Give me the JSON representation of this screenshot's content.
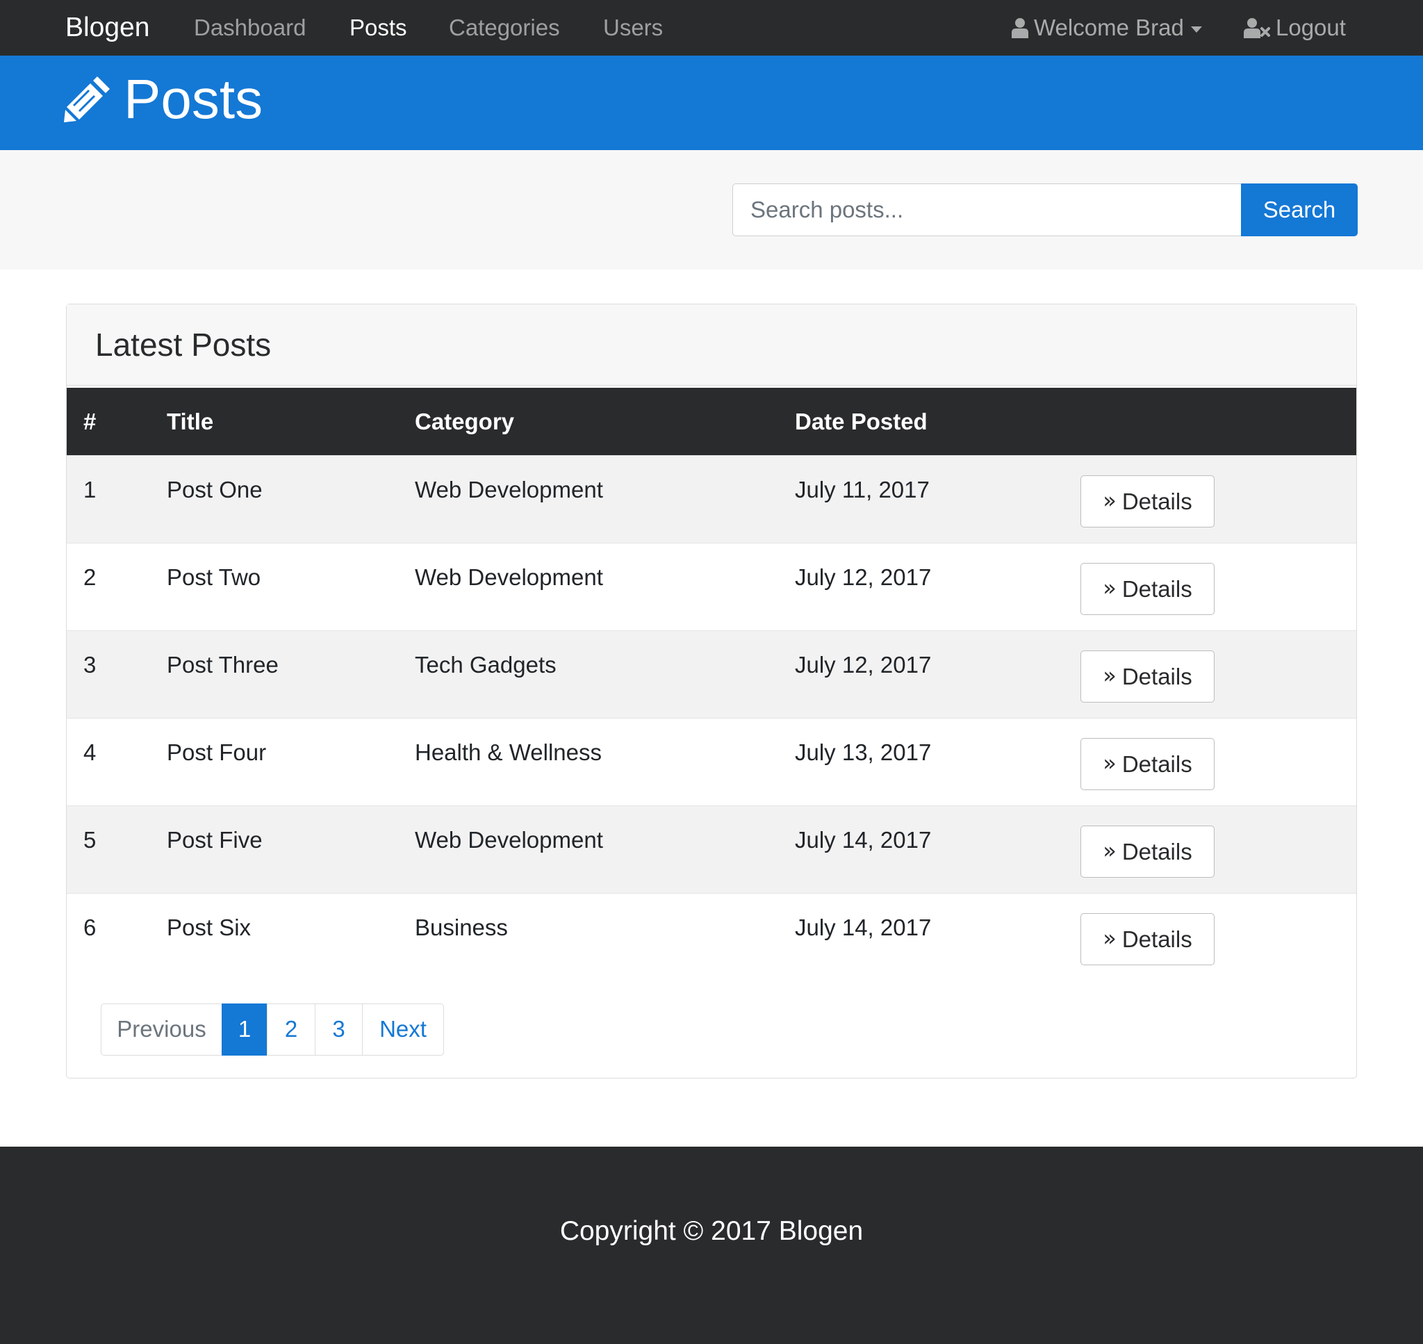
{
  "navbar": {
    "brand": "Blogen",
    "links": [
      {
        "label": "Dashboard",
        "active": false
      },
      {
        "label": "Posts",
        "active": true
      },
      {
        "label": "Categories",
        "active": false
      },
      {
        "label": "Users",
        "active": false
      }
    ],
    "user_menu_label": "Welcome Brad",
    "logout_label": "Logout",
    "icons": {
      "user": "user-icon",
      "logout": "user-times-icon",
      "caret": "caret-down-icon"
    }
  },
  "header": {
    "title": "Posts",
    "icon": "pencil-icon"
  },
  "search": {
    "placeholder": "Search posts...",
    "value": "",
    "button_label": "Search"
  },
  "card": {
    "title": "Latest Posts",
    "columns": [
      "#",
      "Title",
      "Category",
      "Date Posted"
    ],
    "rows": [
      {
        "num": "1",
        "title": "Post One",
        "category": "Web Development",
        "date": "July 11, 2017",
        "action": "Details"
      },
      {
        "num": "2",
        "title": "Post Two",
        "category": "Web Development",
        "date": "July 12, 2017",
        "action": "Details"
      },
      {
        "num": "3",
        "title": "Post Three",
        "category": "Tech Gadgets",
        "date": "July 12, 2017",
        "action": "Details"
      },
      {
        "num": "4",
        "title": "Post Four",
        "category": "Health & Wellness",
        "date": "July 13, 2017",
        "action": "Details"
      },
      {
        "num": "5",
        "title": "Post Five",
        "category": "Web Development",
        "date": "July 14, 2017",
        "action": "Details"
      },
      {
        "num": "6",
        "title": "Post Six",
        "category": "Business",
        "date": "July 14, 2017",
        "action": "Details"
      }
    ],
    "action_icon": "angle-double-right-icon"
  },
  "pagination": {
    "previous_label": "Previous",
    "pages": [
      "1",
      "2",
      "3"
    ],
    "current_page": "1",
    "next_label": "Next"
  },
  "footer": {
    "copyright": "Copyright © 2017 Blogen"
  },
  "colors": {
    "primary": "#1478d5",
    "dark": "#292b2c",
    "light_bg": "#f7f7f7"
  }
}
